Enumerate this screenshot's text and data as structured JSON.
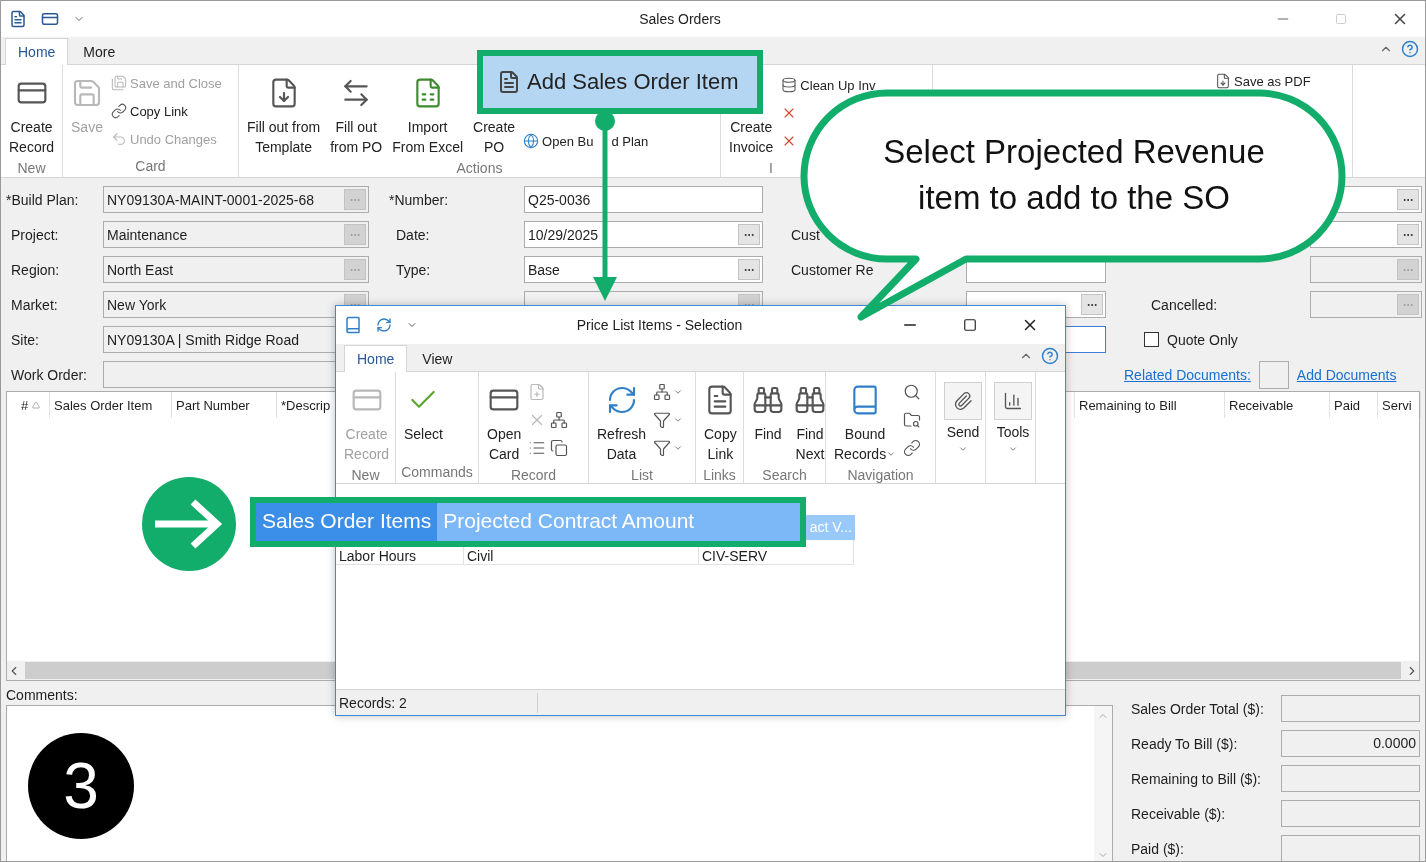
{
  "window": {
    "title": "Sales Orders"
  },
  "ribbon_tabs": [
    {
      "label": "Home",
      "selected": true
    },
    {
      "label": "More",
      "selected": false
    }
  ],
  "ribbon_groups": [
    {
      "label": "New",
      "items": [
        {
          "kind": "large",
          "lines": [
            "Create",
            "Record"
          ],
          "disabled": false
        }
      ]
    },
    {
      "label": "Card",
      "items": [
        {
          "kind": "large",
          "lines": [
            "Save"
          ],
          "disabled": true
        },
        {
          "kind": "small",
          "label": "Save and Close",
          "disabled": true
        },
        {
          "kind": "small",
          "label": "Copy Link",
          "disabled": false
        },
        {
          "kind": "small",
          "label": "Undo Changes",
          "disabled": true
        }
      ]
    },
    {
      "label": "Actions",
      "items": [
        {
          "kind": "large",
          "lines": [
            "Fill out from",
            "Template"
          ],
          "disabled": false
        },
        {
          "kind": "large",
          "lines": [
            "Fill out",
            "from PO"
          ],
          "disabled": false
        },
        {
          "kind": "large",
          "lines": [
            "Import",
            "From Excel"
          ],
          "disabled": false
        },
        {
          "kind": "large",
          "lines": [
            "Create",
            "PO"
          ],
          "disabled": false
        },
        {
          "kind": "small",
          "label": "Open Bu",
          "label_rest": "d Plan",
          "disabled": false
        }
      ]
    },
    {
      "label": "I",
      "items": [
        {
          "kind": "large",
          "lines": [
            "Create",
            "Invoice"
          ],
          "disabled": false
        },
        {
          "kind": "small",
          "label": "Clean Up Inv",
          "disabled": false
        },
        {
          "kind": "small",
          "disabled": false
        },
        {
          "kind": "small",
          "disabled": false
        }
      ]
    },
    {
      "items": [
        {
          "kind": "small",
          "label": "Save as PDF",
          "disabled": false
        }
      ]
    }
  ],
  "form_columns": [
    {
      "rows": [
        {
          "label": "*Build Plan:",
          "kind": "lookup",
          "value": "NY09130A-MAINT-0001-2025-68",
          "disabled": true
        },
        {
          "label": "Project:",
          "kind": "lookup",
          "value": "Maintenance",
          "disabled": true
        },
        {
          "label": "Region:",
          "kind": "lookup",
          "value": "North East",
          "disabled": true
        },
        {
          "label": "Market:",
          "kind": "lookup",
          "value": "New York",
          "disabled": true
        },
        {
          "label": "Site:",
          "kind": "text",
          "value": "NY09130A | Smith Ridge Road",
          "disabled": true
        },
        {
          "label": "Work Order:",
          "kind": "text",
          "disabled": true
        }
      ]
    },
    {
      "rows": [
        {
          "label": "*Number:",
          "kind": "text",
          "value": "Q25-0036",
          "disabled": false
        },
        {
          "label": "Date:",
          "kind": "lookup",
          "value": "10/29/2025",
          "disabled": false
        },
        {
          "label": "Type:",
          "kind": "lookup",
          "value": "Base",
          "disabled": false
        },
        {
          "kind": "lookup",
          "disabled": true
        }
      ]
    },
    {
      "rows": [
        {
          "kind": "blank"
        },
        {
          "label": "Cust",
          "kind": "label"
        },
        {
          "label": "Customer Re",
          "kind": "text",
          "disabled": false
        },
        {
          "kind": "lookup",
          "disabled": false
        },
        {
          "kind": "text",
          "disabled": false,
          "focused": true
        }
      ]
    },
    {
      "rows": [
        {
          "kind": "lookup",
          "disabled": false
        },
        {
          "kind": "lookup",
          "disabled": false
        },
        {
          "kind": "lookup",
          "disabled": true
        },
        {
          "label": "Cancelled:",
          "kind": "lookup",
          "disabled": true
        },
        {
          "kind": "checkbox",
          "label": "Quote Only",
          "checked": false
        },
        {
          "kind": "links",
          "links": [
            "Related Documents:",
            "Add Documents"
          ]
        }
      ]
    }
  ],
  "grid": {
    "columns": [
      "#",
      "Sales Order Item",
      "Part Number",
      "*Descrip",
      "Remaining to Bill",
      "Receivable",
      "Paid",
      "Servi"
    ]
  },
  "comments": {
    "label": "Comments:"
  },
  "totals": [
    {
      "label": "Sales Order Total ($):"
    },
    {
      "label": "Ready To Bill ($):",
      "value": "0.0000"
    },
    {
      "label": "Remaining to Bill ($):"
    },
    {
      "label": "Receivable ($):"
    },
    {
      "label": "Paid ($):"
    }
  ],
  "dialog": {
    "title": "Price List Items - Selection",
    "tabs": [
      {
        "label": "Home",
        "selected": true
      },
      {
        "label": "View",
        "selected": false
      }
    ],
    "groups": [
      {
        "label": "New",
        "items": [
          {
            "kind": "large",
            "lines": [
              "Create",
              "Record"
            ],
            "disabled": true
          }
        ]
      },
      {
        "label": "Commands",
        "items": [
          {
            "kind": "large",
            "lines": [
              "Select"
            ],
            "disabled": false
          }
        ]
      },
      {
        "label": "Record",
        "items": [
          {
            "kind": "large",
            "lines": [
              "Open",
              "Card"
            ],
            "disabled": false
          },
          {
            "kind": "icon",
            "disabled": true
          },
          {
            "kind": "icon",
            "disabled": true
          },
          {
            "kind": "icon",
            "disabled": false
          },
          {
            "kind": "icon",
            "disabled": false
          },
          {
            "kind": "icon",
            "disabled": false
          }
        ]
      },
      {
        "label": "List",
        "items": [
          {
            "kind": "large",
            "lines": [
              "Refresh",
              "Data"
            ],
            "disabled": false
          },
          {
            "kind": "icon",
            "disabled": false,
            "dropdown": true
          },
          {
            "kind": "icon",
            "disabled": false,
            "dropdown": true
          },
          {
            "kind": "icon",
            "disabled": false,
            "dropdown": true
          }
        ]
      },
      {
        "label": "Links",
        "items": [
          {
            "kind": "large",
            "lines": [
              "Copy",
              "Link"
            ],
            "disabled": false
          }
        ]
      },
      {
        "label": "Search",
        "items": [
          {
            "kind": "large",
            "lines": [
              "Find"
            ],
            "disabled": false
          },
          {
            "kind": "large",
            "lines": [
              "Find",
              "Next"
            ],
            "disabled": false
          }
        ]
      },
      {
        "label": "Navigation",
        "items": [
          {
            "kind": "large",
            "lines": [
              "Bound",
              "Records"
            ],
            "disabled": false,
            "dropdown": true
          },
          {
            "kind": "icon",
            "disabled": false
          },
          {
            "kind": "icon",
            "disabled": false
          },
          {
            "kind": "icon",
            "disabled": false
          }
        ]
      },
      {
        "items": [
          {
            "kind": "menu",
            "lines": [
              "Send"
            ],
            "disabled": false
          }
        ]
      },
      {
        "items": [
          {
            "kind": "menu",
            "lines": [
              "Tools"
            ],
            "disabled": false
          }
        ]
      }
    ],
    "rows": [
      {
        "selected": true,
        "cells": [
          "act V..."
        ]
      },
      {
        "selected": false,
        "cells": [
          "Labor Hours",
          "Civil",
          "CIV-SERV"
        ]
      }
    ],
    "status": "Records: 2"
  },
  "highlight": {
    "label": "Add Sales Order Item"
  },
  "row_callout": {
    "cells": [
      "Sales Order Items",
      "Projected Contract Amount"
    ]
  },
  "speech_bubble": {
    "lines": [
      "Select Projected Revenue",
      "item to add to the SO"
    ]
  },
  "step_badge": "3"
}
